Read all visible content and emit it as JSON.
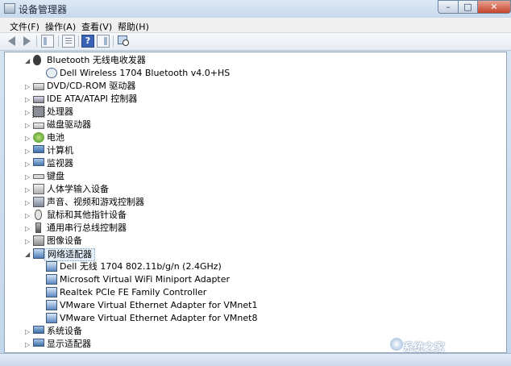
{
  "window": {
    "title": "设备管理器"
  },
  "window_buttons": {
    "minimize": "–",
    "maximize": "□",
    "close": "✕"
  },
  "menu": [
    {
      "label": "文件(F)"
    },
    {
      "label": "操作(A)"
    },
    {
      "label": "查看(V)"
    },
    {
      "label": "帮助(H)"
    }
  ],
  "toolbar": {
    "help_glyph": "?"
  },
  "tree": [
    {
      "label": "Bluetooth 无线电收发器",
      "level": 1,
      "expanded": true,
      "icon": "bluetooth-icon"
    },
    {
      "label": "Dell Wireless 1704 Bluetooth v4.0+HS",
      "level": 2,
      "icon": "bluetooth-device-icon"
    },
    {
      "label": "DVD/CD-ROM 驱动器",
      "level": 1,
      "expanded": false,
      "icon": "dvd-drive-icon"
    },
    {
      "label": "IDE ATA/ATAPI 控制器",
      "level": 1,
      "expanded": false,
      "icon": "ide-controller-icon"
    },
    {
      "label": "处理器",
      "level": 1,
      "expanded": false,
      "icon": "processor-icon"
    },
    {
      "label": "磁盘驱动器",
      "level": 1,
      "expanded": false,
      "icon": "disk-drive-icon"
    },
    {
      "label": "电池",
      "level": 1,
      "expanded": false,
      "icon": "battery-icon"
    },
    {
      "label": "计算机",
      "level": 1,
      "expanded": false,
      "icon": "computer-icon"
    },
    {
      "label": "监视器",
      "level": 1,
      "expanded": false,
      "icon": "monitor-icon"
    },
    {
      "label": "键盘",
      "level": 1,
      "expanded": false,
      "icon": "keyboard-icon"
    },
    {
      "label": "人体学输入设备",
      "level": 1,
      "expanded": false,
      "icon": "hid-icon"
    },
    {
      "label": "声音、视频和游戏控制器",
      "level": 1,
      "expanded": false,
      "icon": "sound-icon"
    },
    {
      "label": "鼠标和其他指针设备",
      "level": 1,
      "expanded": false,
      "icon": "mouse-icon"
    },
    {
      "label": "通用串行总线控制器",
      "level": 1,
      "expanded": false,
      "icon": "usb-icon"
    },
    {
      "label": "图像设备",
      "level": 1,
      "expanded": false,
      "icon": "imaging-device-icon"
    },
    {
      "label": "网络适配器",
      "level": 1,
      "expanded": true,
      "selected": true,
      "icon": "network-adapter-icon"
    },
    {
      "label": "Dell 无线 1704 802.11b/g/n (2.4GHz)",
      "level": 2,
      "icon": "network-card-icon"
    },
    {
      "label": "Microsoft Virtual WiFi Miniport Adapter",
      "level": 2,
      "icon": "network-card-icon"
    },
    {
      "label": "Realtek PCIe FE Family Controller",
      "level": 2,
      "icon": "network-card-icon"
    },
    {
      "label": "VMware Virtual Ethernet Adapter for VMnet1",
      "level": 2,
      "icon": "network-card-icon"
    },
    {
      "label": "VMware Virtual Ethernet Adapter for VMnet8",
      "level": 2,
      "icon": "network-card-icon"
    },
    {
      "label": "系统设备",
      "level": 1,
      "expanded": false,
      "icon": "system-device-icon"
    },
    {
      "label": "显示适配器",
      "level": 1,
      "expanded": false,
      "icon": "display-adapter-icon"
    }
  ],
  "watermark": {
    "text": "系统之家"
  },
  "colors": {
    "accent": "#3a6ea5",
    "selection_bg": "#e8f2fd",
    "window_frame": "#c3d6ea"
  }
}
